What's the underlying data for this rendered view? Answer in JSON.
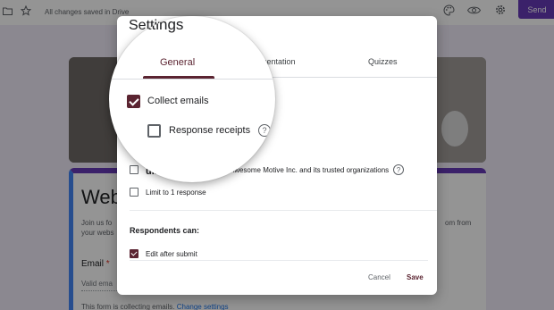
{
  "topbar": {
    "saved_status": "All changes saved in Drive",
    "send_label": "Send",
    "icons": [
      "folder-icon",
      "star-icon",
      "palette-icon",
      "eye-icon",
      "gear-icon"
    ]
  },
  "form": {
    "title": "Web",
    "description_left": "Join us fo\nyour webs",
    "description_right": "om from",
    "email_label": "Email",
    "required_mark": "*",
    "email_placeholder": "Valid ema",
    "collecting_notice": "This form is collecting emails.",
    "change_settings_link": "Change settings"
  },
  "dialog": {
    "title": "Settings",
    "tabs": [
      {
        "label": "General",
        "active": true
      },
      {
        "label": "resentation",
        "active": false
      },
      {
        "label": "Quizzes",
        "active": false
      }
    ],
    "collect_emails": {
      "label": "Collect emails",
      "checked": true
    },
    "response_receipts": {
      "label": "Response receipts",
      "checked": false
    },
    "requires_sign_in": {
      "label": "uires sign in:",
      "org": "Awesome Motive Inc. and its trusted organizations",
      "checked": false
    },
    "limit_one_response": {
      "label": "Limit to 1 response",
      "checked": false
    },
    "respondents_heading": "Respondents can:",
    "edit_after_submit": {
      "label": "Edit after submit",
      "checked": true
    },
    "cancel_label": "Cancel",
    "save_label": "Save",
    "help_glyph": "?"
  },
  "colors": {
    "accent": "#5b2431",
    "send_button": "#673ab7",
    "overlay": "rgba(0,0,0,0.42)"
  }
}
